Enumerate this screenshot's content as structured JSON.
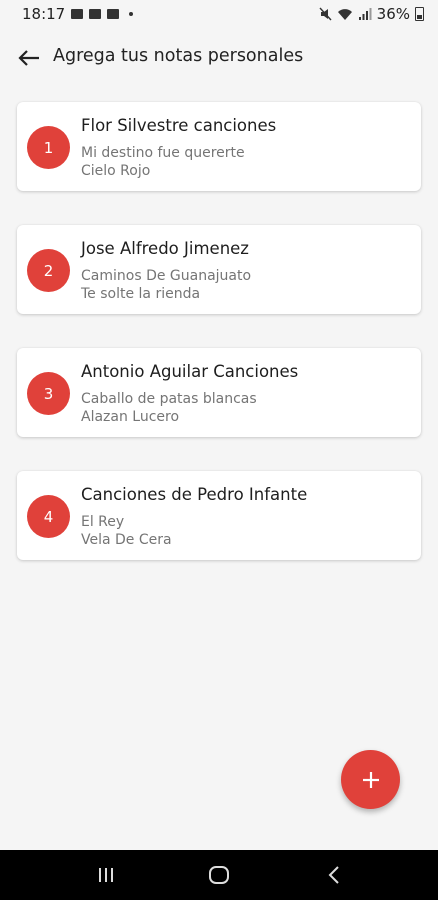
{
  "status_bar": {
    "time": "18:17",
    "battery": "36%",
    "icons_left": [
      "gallery-icon",
      "mail-icon",
      "notification-icon",
      "dot-icon"
    ],
    "icons_right": [
      "mute-icon",
      "wifi-icon",
      "signal-icon",
      "battery-icon"
    ]
  },
  "header": {
    "back_icon": "arrow-left-icon",
    "title": "Agrega tus notas personales"
  },
  "notes": [
    {
      "number": "1",
      "title": "Flor Silvestre canciones",
      "line1": "Mi destino fue quererte",
      "line2": "Cielo Rojo"
    },
    {
      "number": "2",
      "title": "Jose Alfredo Jimenez",
      "line1": "Caminos De Guanajuato",
      "line2": "Te solte la rienda"
    },
    {
      "number": "3",
      "title": "Antonio Aguilar Canciones",
      "line1": "Caballo de patas blancas",
      "line2": "Alazan Lucero"
    },
    {
      "number": "4",
      "title": "Canciones de Pedro Infante",
      "line1": "El Rey",
      "line2": "Vela De Cera"
    }
  ],
  "fab": {
    "icon": "plus-icon"
  },
  "nav_bar": {
    "buttons": [
      "recent-apps-icon",
      "home-icon",
      "back-icon"
    ]
  },
  "colors": {
    "accent": "#e0413a",
    "background": "#f5f5f5",
    "card": "#ffffff",
    "nav_bar": "#000000"
  }
}
